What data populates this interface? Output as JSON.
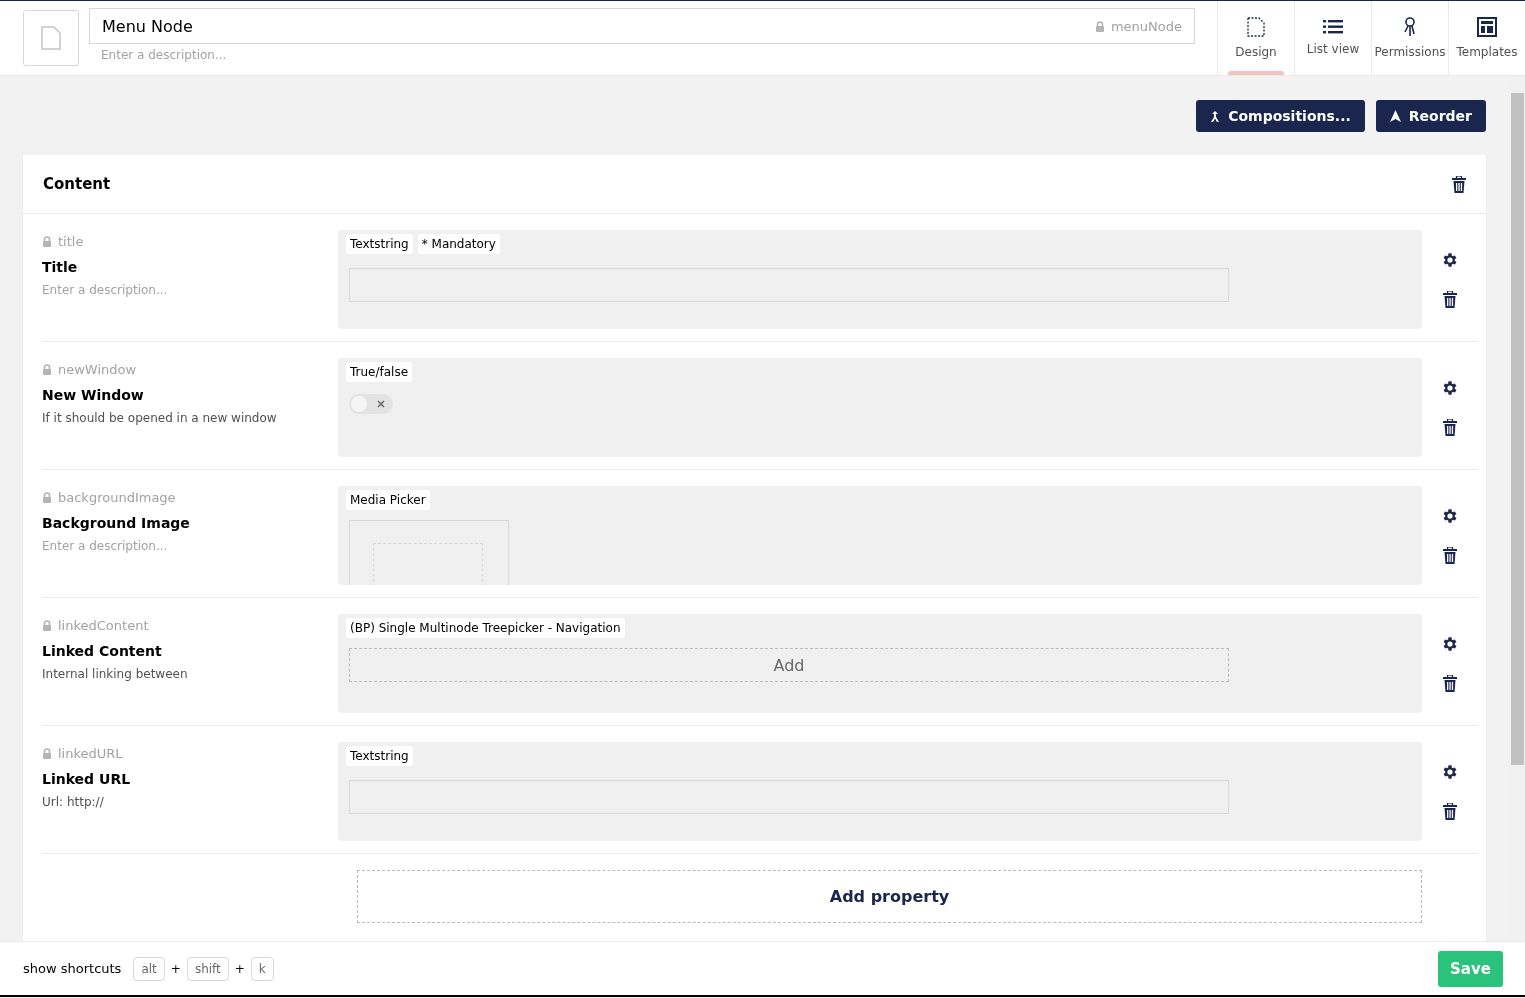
{
  "header": {
    "name": "Menu Node",
    "alias": "menuNode",
    "description_placeholder": "Enter a description..."
  },
  "tabs": [
    {
      "label": "Design",
      "selected": true,
      "kind": "design"
    },
    {
      "label": "List view",
      "selected": false,
      "kind": "list"
    },
    {
      "label": "Permissions",
      "selected": false,
      "kind": "permissions"
    },
    {
      "label": "Templates",
      "selected": false,
      "kind": "templates"
    }
  ],
  "actions": [
    {
      "label": "Compositions...",
      "kind": "compositions"
    },
    {
      "label": "Reorder",
      "kind": "reorder"
    }
  ],
  "group": {
    "title": "Content",
    "properties": [
      {
        "alias": "title",
        "name": "Title",
        "description": "Enter a description...",
        "description_is_placeholder": true,
        "tags": [
          "Textstring",
          "* Mandatory"
        ],
        "kind": "textbox"
      },
      {
        "alias": "newWindow",
        "name": "New Window",
        "description": "If it should be opened in a new window",
        "description_is_placeholder": false,
        "tags": [
          "True/false"
        ],
        "kind": "toggle",
        "on": false
      },
      {
        "alias": "backgroundImage",
        "name": "Background Image",
        "description": "Enter a description...",
        "description_is_placeholder": true,
        "tags": [
          "Media Picker"
        ],
        "kind": "media"
      },
      {
        "alias": "linkedContent",
        "name": "Linked Content",
        "description": "Internal linking between",
        "description_is_placeholder": false,
        "tags": [
          "(BP) Single Multinode Treepicker - Navigation"
        ],
        "kind": "treepicker",
        "add_label": "Add"
      },
      {
        "alias": "linkedURL",
        "name": "Linked URL",
        "description": "Url: http://",
        "description_is_placeholder": false,
        "tags": [
          "Textstring"
        ],
        "kind": "textbox"
      }
    ],
    "add_property": "Add property"
  },
  "footer": {
    "shortcuts_label": "show shortcuts",
    "keys": [
      "alt",
      "shift",
      "k"
    ],
    "separator": "+",
    "save": "Save"
  }
}
